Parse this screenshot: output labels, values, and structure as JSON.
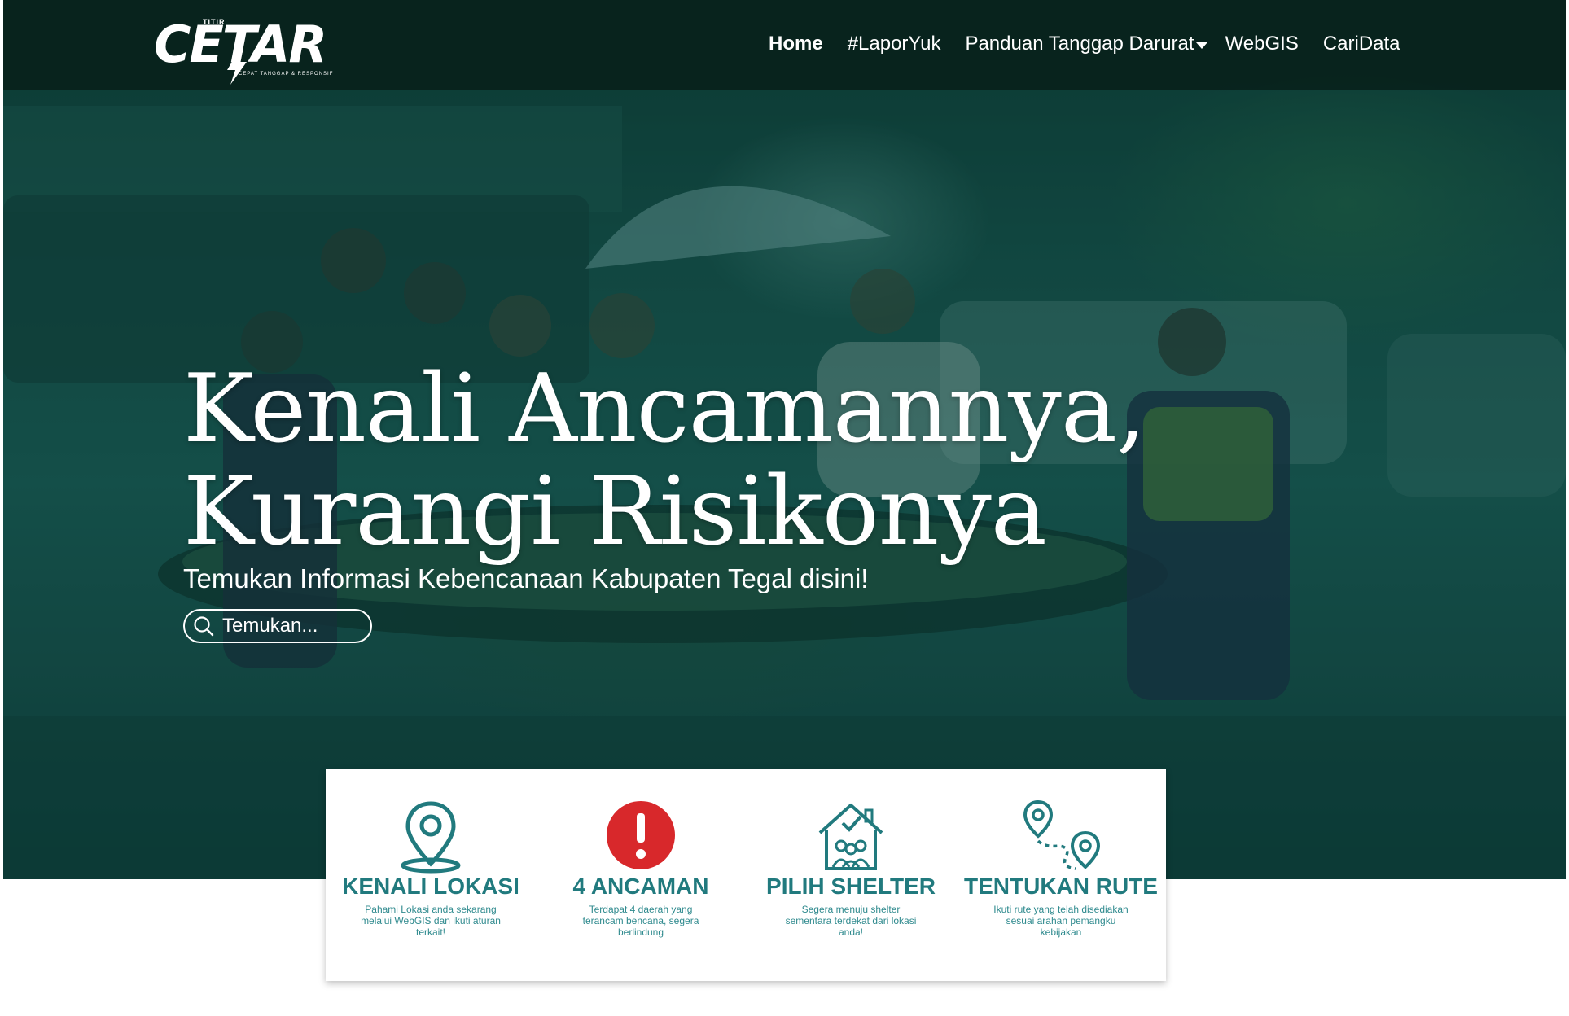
{
  "brand": {
    "small_text": "TITIR",
    "name": "CETAR",
    "tagline": "CEPAT TANGGAP & RESPONSIF"
  },
  "nav": {
    "items": [
      {
        "label": "Home",
        "active": true,
        "icon": null
      },
      {
        "label": "#LaporYuk",
        "active": false,
        "icon": null
      },
      {
        "label": "Panduan Tanggap Darurat",
        "active": false,
        "icon": "caret-down-icon"
      },
      {
        "label": "WebGIS",
        "active": false,
        "icon": null
      },
      {
        "label": "CariData",
        "active": false,
        "icon": null
      }
    ]
  },
  "hero": {
    "headline_line1": "Kenali Ancamannya,",
    "headline_line2": "Kurangi Risikonya",
    "subheadline": "Temukan Informasi Kebencanaan Kabupaten Tegal disini!",
    "search": {
      "placeholder": "Temukan...",
      "value": "",
      "icon": "search-icon"
    }
  },
  "features": [
    {
      "icon": "location-pin-icon",
      "title": "KENALI LOKASI",
      "desc": "Pahami Lokasi anda sekarang melalui WebGIS dan ikuti aturan terkait!"
    },
    {
      "icon": "alert-icon",
      "title": "4 ANCAMAN",
      "desc": "Terdapat 4 daerah yang terancam bencana, segera berlindung"
    },
    {
      "icon": "shelter-icon",
      "title": "PILIH SHELTER",
      "desc": "Segera menuju shelter sementara terdekat dari lokasi anda!"
    },
    {
      "icon": "route-icon",
      "title": "TENTUKAN RUTE",
      "desc": "Ikuti rute yang telah disediakan sesuai arahan pemangku kebijakan"
    }
  ],
  "colors": {
    "accent_teal": "#217a7e",
    "alert_red": "#d8282b",
    "navbar_bg": "#08201a",
    "hero_tint": "#0d3a33"
  }
}
